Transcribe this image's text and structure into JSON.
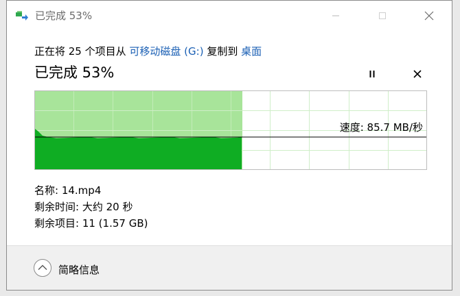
{
  "window": {
    "title": "已完成 53%"
  },
  "header": {
    "desc_prefix": "正在将 25 个项目从 ",
    "source": "可移动磁盘 (G:)",
    "desc_middle": " 复制到 ",
    "destination": "桌面",
    "progress_text": "已完成 53%"
  },
  "progress": {
    "percent": 53,
    "speed_label": "速度: 85.7 MB/秒"
  },
  "details": {
    "name_label": "名称: ",
    "name_value": "14.mp4",
    "time_label": "剩余时间: ",
    "time_value": "大约 20 秒",
    "items_label": "剩余项目: ",
    "items_value": "11 (1.57 GB)"
  },
  "footer": {
    "collapse_label": "简略信息"
  },
  "colors": {
    "progress_light": "#a8e49a",
    "progress_dark": "#0fad23",
    "grid_line": "#c9ecc2",
    "link": "#1a5fb4"
  },
  "icons": {
    "title": "copy-arrow-icon",
    "minimize": "minimize-icon",
    "maximize": "maximize-icon",
    "close": "close-icon",
    "pause": "pause-icon",
    "cancel": "cancel-icon",
    "collapse": "chevron-up-icon"
  }
}
